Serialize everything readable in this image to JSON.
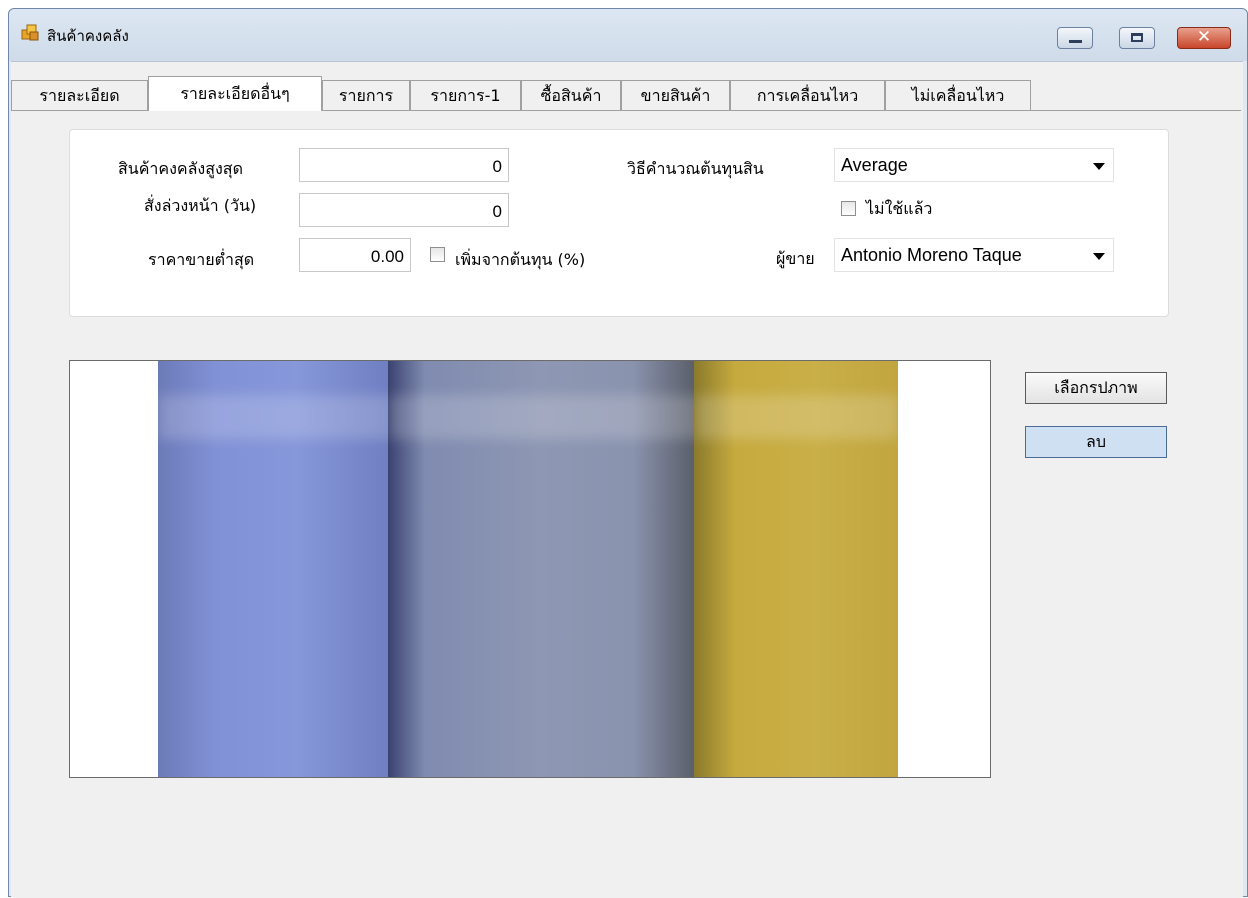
{
  "window": {
    "title": "สินค้าคงคลัง",
    "icon": "boxes-icon"
  },
  "tabs": [
    {
      "label": "รายละเอียด",
      "active": false
    },
    {
      "label": "รายละเอียดอื่นๆ",
      "active": true
    },
    {
      "label": "รายการ",
      "active": false
    },
    {
      "label": "รายการ-1",
      "active": false
    },
    {
      "label": "ซื้อสินค้า",
      "active": false
    },
    {
      "label": "ขายสินค้า",
      "active": false
    },
    {
      "label": "การเคลื่อนไหว",
      "active": false
    },
    {
      "label": "ไม่เคลื่อนไหว",
      "active": false
    }
  ],
  "form": {
    "max_stock_label": "สินค้าคงคลังสูงสุด",
    "max_stock_value": "0",
    "lead_days_label": "สั่งล่วงหน้า (วัน)",
    "lead_days_value": "0",
    "min_price_label": "ราคาขายต่ำสุด",
    "min_price_value": "0.00",
    "markup_label": "เพิ่มจากต้นทุน (%)",
    "markup_checked": false,
    "cost_method_label": "วิธีคำนวณต้นทุนสิน",
    "cost_method_value": "Average",
    "inactive_label": "ไม่ใช้แล้ว",
    "inactive_checked": false,
    "vendor_label": "ผู้ขาย",
    "vendor_value": "Antonio Moreno Taque"
  },
  "picture": {
    "select_label": "เลือกรปภาพ",
    "delete_label": "ลบ"
  },
  "colors": {
    "title_bg": "#dde7f3",
    "close_button": "#c9462b",
    "delete_button_bg": "#cfe0f3"
  }
}
